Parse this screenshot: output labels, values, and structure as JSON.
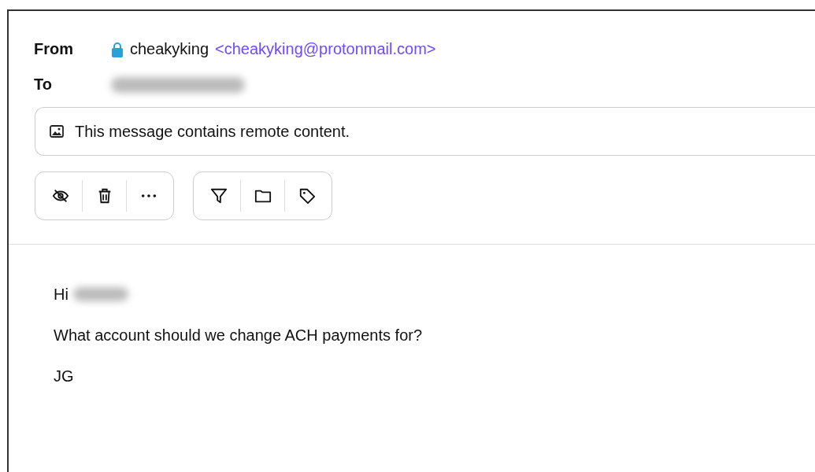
{
  "header": {
    "from_label": "From",
    "sender_name": "cheakyking",
    "sender_address": "<cheakyking@protonmail.com>",
    "sender_verified": true,
    "to_label": "To",
    "to_redacted": true
  },
  "banner": {
    "text": "This message contains remote content."
  },
  "toolbar_groups": [
    {
      "buttons": [
        {
          "kind": "hide"
        },
        {
          "kind": "trash"
        },
        {
          "kind": "more"
        }
      ]
    },
    {
      "buttons": [
        {
          "kind": "filter"
        },
        {
          "kind": "folder"
        },
        {
          "kind": "tag"
        }
      ]
    }
  ],
  "body": {
    "greeting": "Hi",
    "greeting_name_redacted": true,
    "lines": [
      "What account should we change ACH payments for?",
      "JG"
    ]
  }
}
